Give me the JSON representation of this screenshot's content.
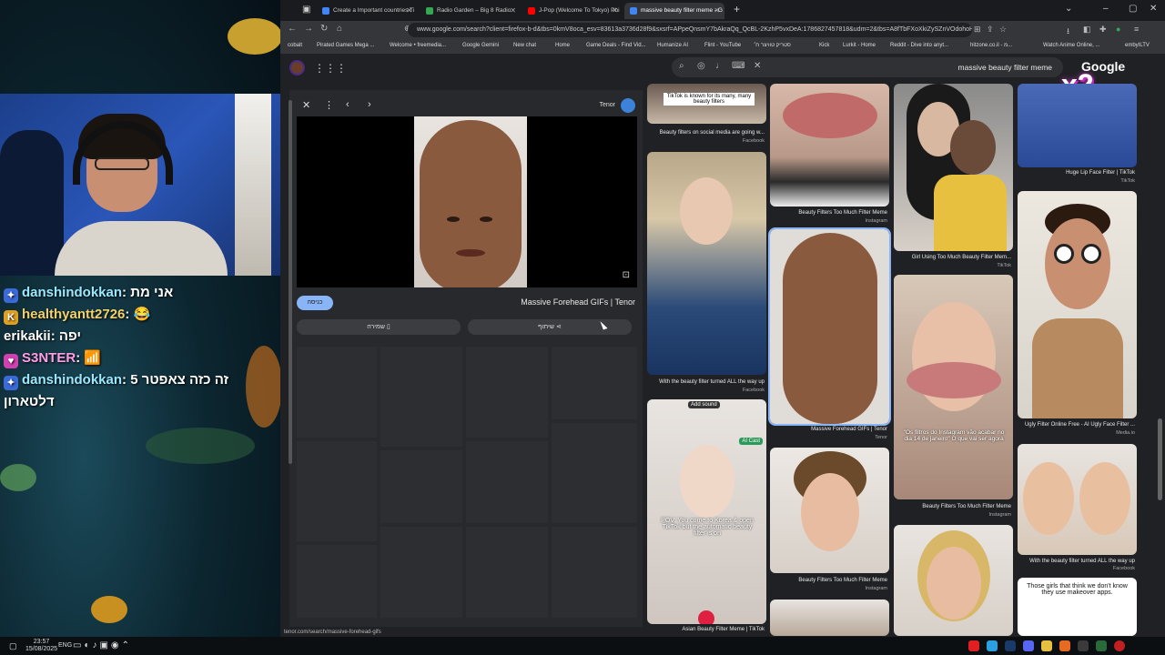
{
  "stream": {
    "chat": [
      {
        "user": "danshindokkan",
        "message": "אני מת"
      },
      {
        "user": "healthyantt2726",
        "message": "😂"
      },
      {
        "user": "erikakii",
        "message": "יפה"
      },
      {
        "user": "S3NTER",
        "message": "📶"
      },
      {
        "user": "danshindokkan",
        "message": "זה כזה צאפטר 5"
      },
      {
        "user": "",
        "message": "דלטארון"
      }
    ],
    "taskbar": {
      "time": "23:57",
      "date": "15/08/2025",
      "lang": "ENG"
    }
  },
  "browser": {
    "tabs": [
      {
        "label": "Create a Important countries Ti",
        "color": "#4285f4"
      },
      {
        "label": "Radio Garden – Big 8 Radio",
        "color": "#34a853"
      },
      {
        "label": "J-Pop (Welcome To Tokyo) Phi",
        "color": "#ff0000"
      },
      {
        "label": "massive beauty filter meme - G",
        "color": "#4285f4"
      }
    ],
    "url": "www.google.com/search?client=firefox-b-d&tbs=0kmV8oca_esv=83613a3736d28f9&sxsrf=APpeQnsmY7bAkraQq_QcBL-2KzhP5vxDeA:1786827457818&udm=2&tbs=A8fTbFXoXkiZySZnVOdohoH...",
    "bookmarks": [
      "cobalt",
      "Pirated Games Mega ...",
      "Welcome • freemedia...",
      "Google Gemini",
      "New chat",
      "Home",
      "Game Deals - Find Vid...",
      "Humanize AI",
      "Flint - YouTube",
      "סטריק טוויצר ח׳",
      "Kick",
      "Lurkit - Home",
      "Reddit - Dive into anyt...",
      "hitzone.co.il - מ...",
      "Watch Anime Online, ...",
      "embyILTV"
    ]
  },
  "google": {
    "query": "massive beauty filter meme",
    "logo": "Google",
    "overlay": "x2"
  },
  "viewer": {
    "source": "Tenor",
    "visit_label": "כניסה",
    "title": "Massive Forehead GIFs | Tenor",
    "save_label": "שמירה",
    "share_label": "שיתוף",
    "status_url": "tenor.com/search/massive-forehead-gifs"
  },
  "results": [
    {
      "caption": "Beauty filters on social media are going w...",
      "source": "Facebook",
      "overlay_text": "TikTok is known for its many, many beauty filters"
    },
    {
      "caption": "With the beauty filter turned ALL the way up",
      "source": "Facebook"
    },
    {
      "caption": "Asian Beauty Filter Meme | TikTok",
      "source": "",
      "overlay_text": "POV: You come to Korea & open TikTok but the automatic beauty filter is on",
      "badge": "Add sound",
      "badge2": "AI Cast"
    },
    {
      "caption": "Beauty Filters Too Much Filter Meme",
      "source": "Instagram"
    },
    {
      "caption": "Massive Forehead GIFs | Tenor",
      "source": "Tenor"
    },
    {
      "caption": "Beauty Filters Too Much Filter Meme",
      "source": "Instagram"
    },
    {
      "caption": "Girl Using Too Much Beauty Filter Mem...",
      "source": "TikTok"
    },
    {
      "caption": "Beauty Filters Too Much Filter Meme",
      "source": "Instagram",
      "overlay_text": "\"Os filtros do Instagram vão acabar no dia 14 de janeiro\" O que vai ser agora"
    },
    {
      "caption": "Huge Lip Face Filter | TikTok",
      "source": "TikTok"
    },
    {
      "caption": "Ugly Filter Online Free - AI Ugly Face Filter ...",
      "source": "Media.io"
    },
    {
      "caption": "With the beauty filter turned ALL the way up",
      "source": "Facebook"
    },
    {
      "caption": "",
      "source": "",
      "overlay_text": "Those girls that think we don't know they use makeover apps."
    }
  ]
}
